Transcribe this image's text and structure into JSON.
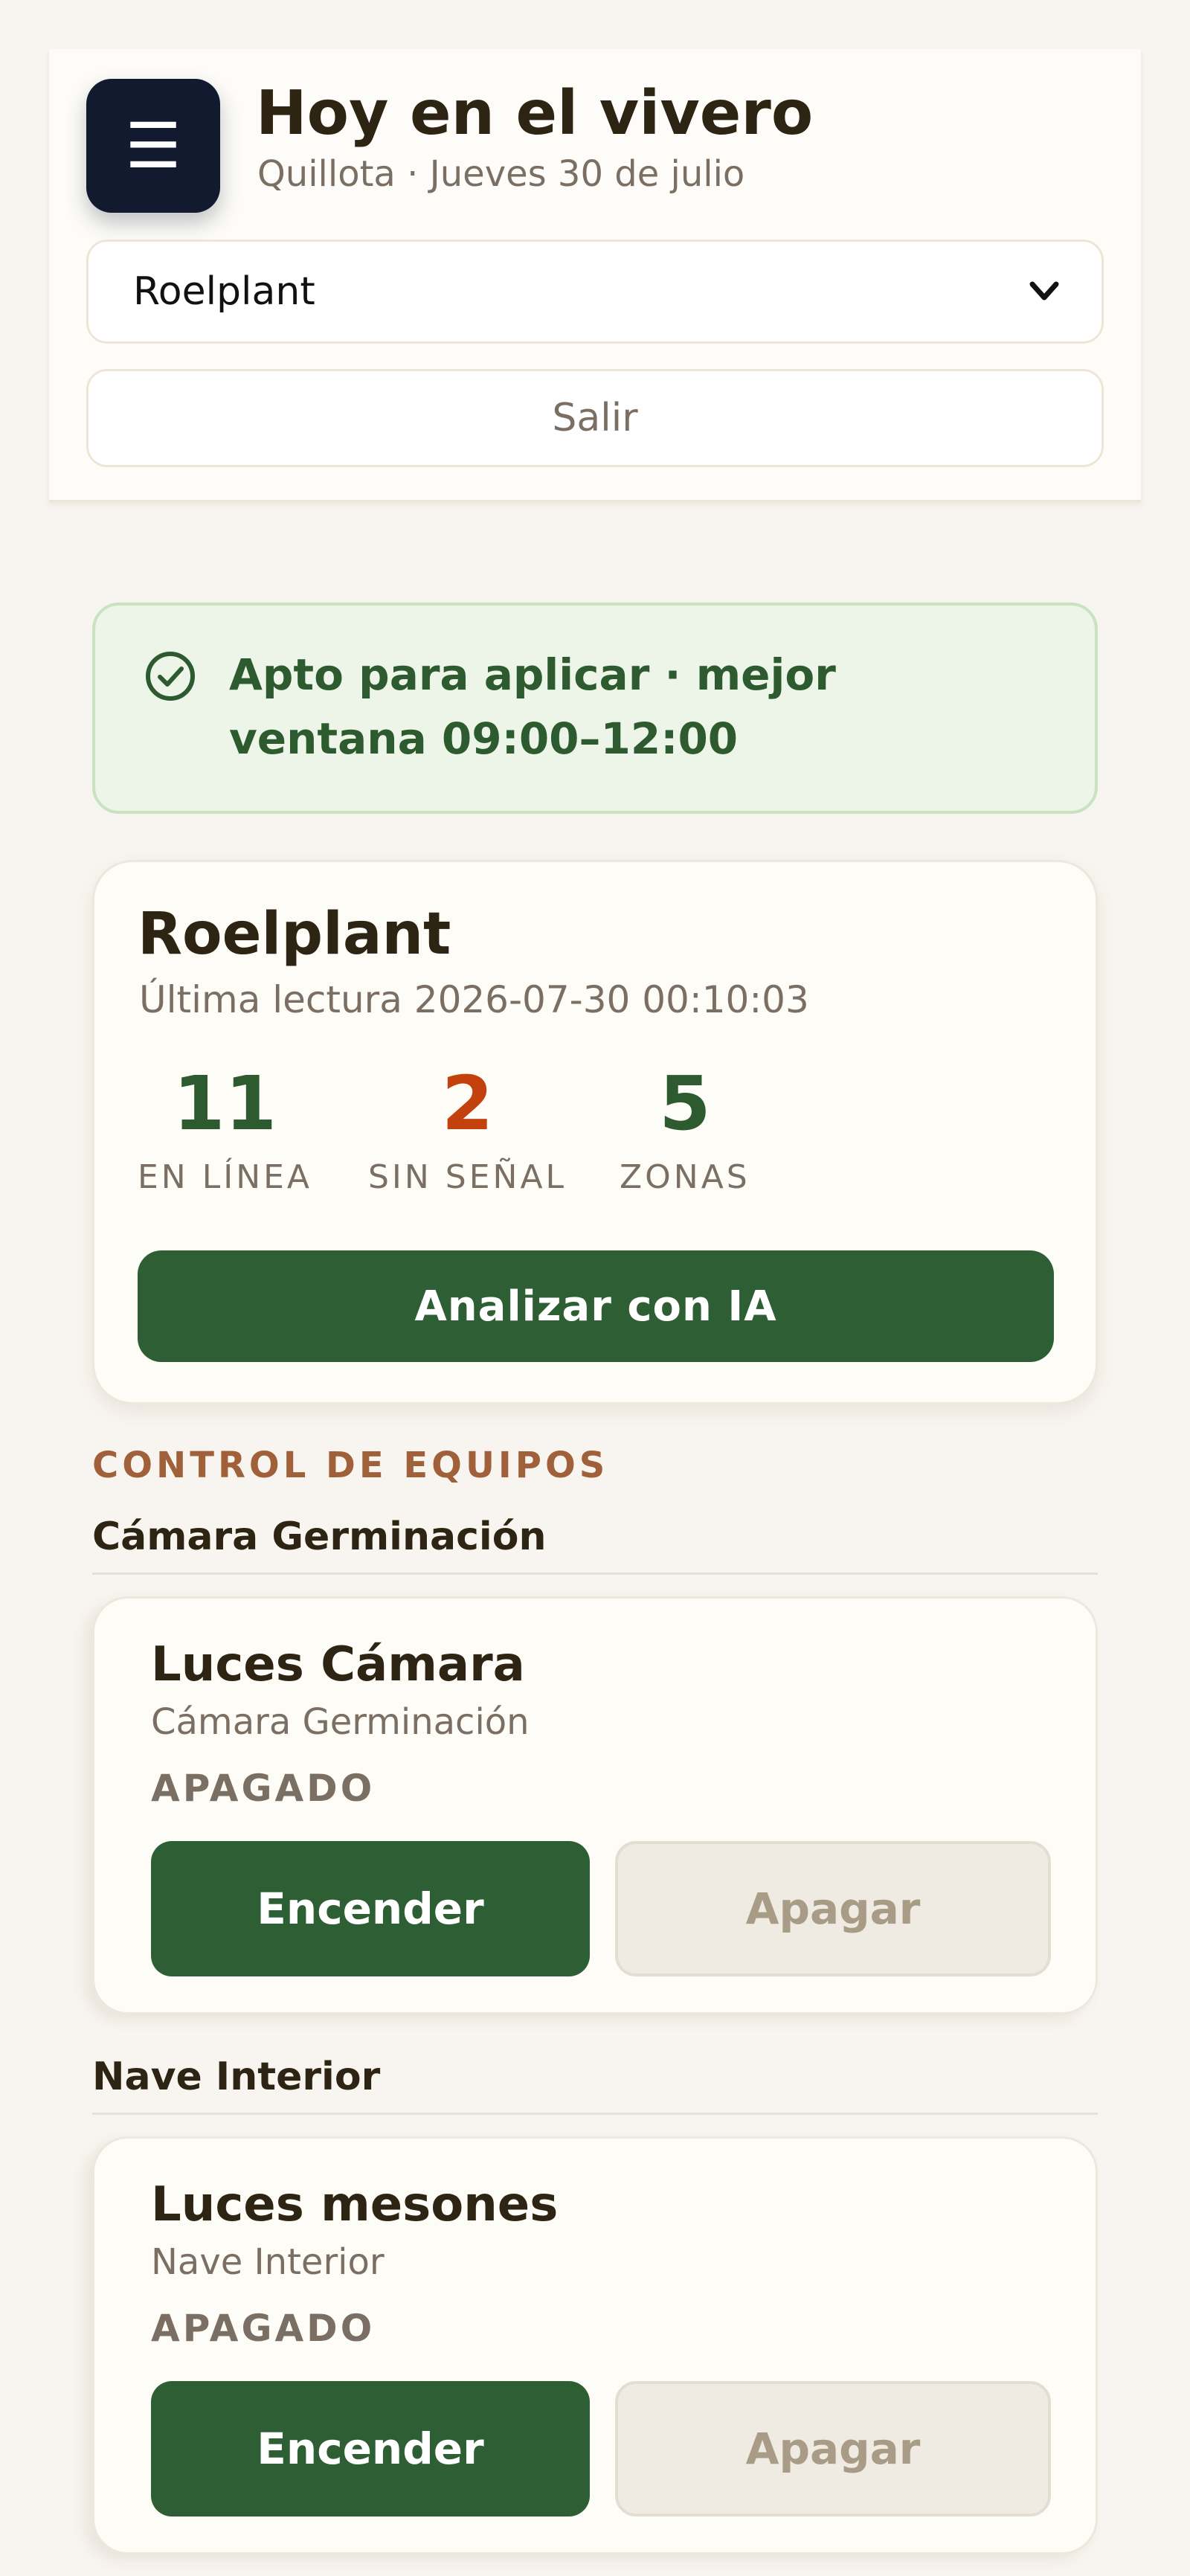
{
  "header": {
    "menu_icon": "hamburger-menu-icon",
    "menu_glyph": "☰",
    "title": "Hoy en el vivero",
    "subtitle": "Quillota · Jueves 30 de julio",
    "nursery_select": {
      "selected": "Roelplant"
    },
    "logout_label": "Salir"
  },
  "alert": {
    "icon": "check-circle-icon",
    "text": "Apto para aplicar · mejor ventana 09:00–12:00",
    "color": "#2d5a2e",
    "background": "#ecf5e8"
  },
  "summary": {
    "name": "Roelplant",
    "last_reading": "Última lectura 2026-07-30 00:10:03",
    "stats": [
      {
        "value": "11",
        "label": "EN LÍNEA",
        "color": "#2d5a2e"
      },
      {
        "value": "2",
        "label": "SIN SEÑAL",
        "color": "#c2410c"
      },
      {
        "value": "5",
        "label": "ZONAS",
        "color": "#2d5a2e"
      }
    ],
    "analyze_label": "Analizar con IA"
  },
  "controls": {
    "section_title": "CONTROL DE EQUIPOS",
    "zones": [
      {
        "title": "Cámara Germinación",
        "device": {
          "name": "Luces Cámara",
          "zone": "Cámara Germinación",
          "state": "APAGADO",
          "on_label": "Encender",
          "off_label": "Apagar"
        }
      },
      {
        "title": "Nave Interior",
        "device": {
          "name": "Luces mesones",
          "zone": "Nave Interior",
          "state": "APAGADO",
          "on_label": "Encender",
          "off_label": "Apagar"
        }
      }
    ]
  },
  "colors": {
    "primary_green": "#2e5e34",
    "accent_orange": "#a0603a",
    "background": "#f8f4ef"
  }
}
